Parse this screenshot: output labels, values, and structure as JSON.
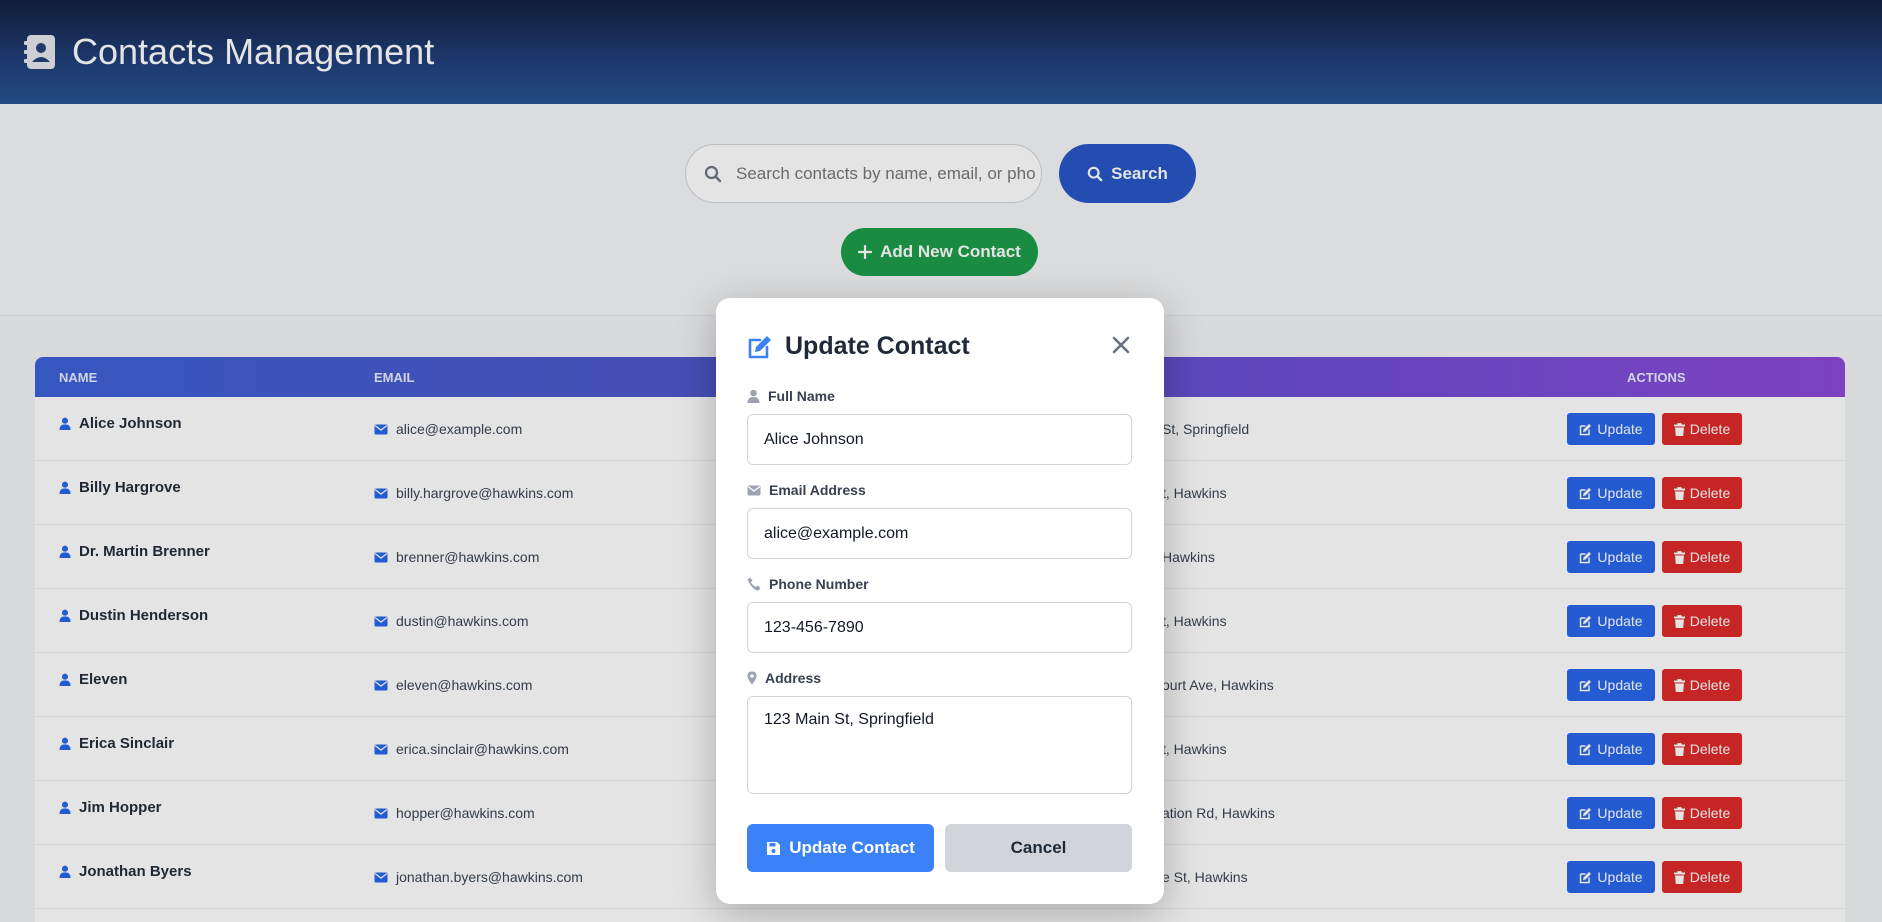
{
  "header": {
    "title": "Contacts Management",
    "logo_icon": "address-book-icon"
  },
  "search": {
    "placeholder": "Search contacts by name, email, or phone",
    "button_label": "Search"
  },
  "add_button_label": "Add New Contact",
  "table": {
    "headers": {
      "name": "Name",
      "email": "Email",
      "actions": "Actions"
    },
    "update_label": "Update",
    "delete_label": "Delete",
    "rows": [
      {
        "name": "Alice Johnson",
        "email": "alice@example.com",
        "address": "St, Springfield"
      },
      {
        "name": "Billy Hargrove",
        "email": "billy.hargrove@hawkins.com",
        "address": "t, Hawkins"
      },
      {
        "name": "Dr. Martin Brenner",
        "email": "brenner@hawkins.com",
        "address": "Hawkins"
      },
      {
        "name": "Dustin Henderson",
        "email": "dustin@hawkins.com",
        "address": "t, Hawkins"
      },
      {
        "name": "Eleven",
        "email": "eleven@hawkins.com",
        "address": "ourt Ave, Hawkins"
      },
      {
        "name": "Erica Sinclair",
        "email": "erica.sinclair@hawkins.com",
        "address": "t, Hawkins"
      },
      {
        "name": "Jim Hopper",
        "email": "hopper@hawkins.com",
        "address": "ation Rd, Hawkins"
      },
      {
        "name": "Jonathan Byers",
        "email": "jonathan.byers@hawkins.com",
        "address": "e St, Hawkins"
      }
    ]
  },
  "modal": {
    "title": "Update Contact",
    "fields": {
      "name": {
        "label": "Full Name",
        "value": "Alice Johnson"
      },
      "email": {
        "label": "Email Address",
        "value": "alice@example.com"
      },
      "phone": {
        "label": "Phone Number",
        "value": "123-456-7890"
      },
      "address": {
        "label": "Address",
        "value": "123 Main St, Springfield"
      }
    },
    "submit_label": "Update Contact",
    "cancel_label": "Cancel"
  },
  "colors": {
    "primary": "#2554c7",
    "success": "#1a9b47",
    "danger": "#dc2626",
    "modal_accent": "#3b82f6"
  }
}
